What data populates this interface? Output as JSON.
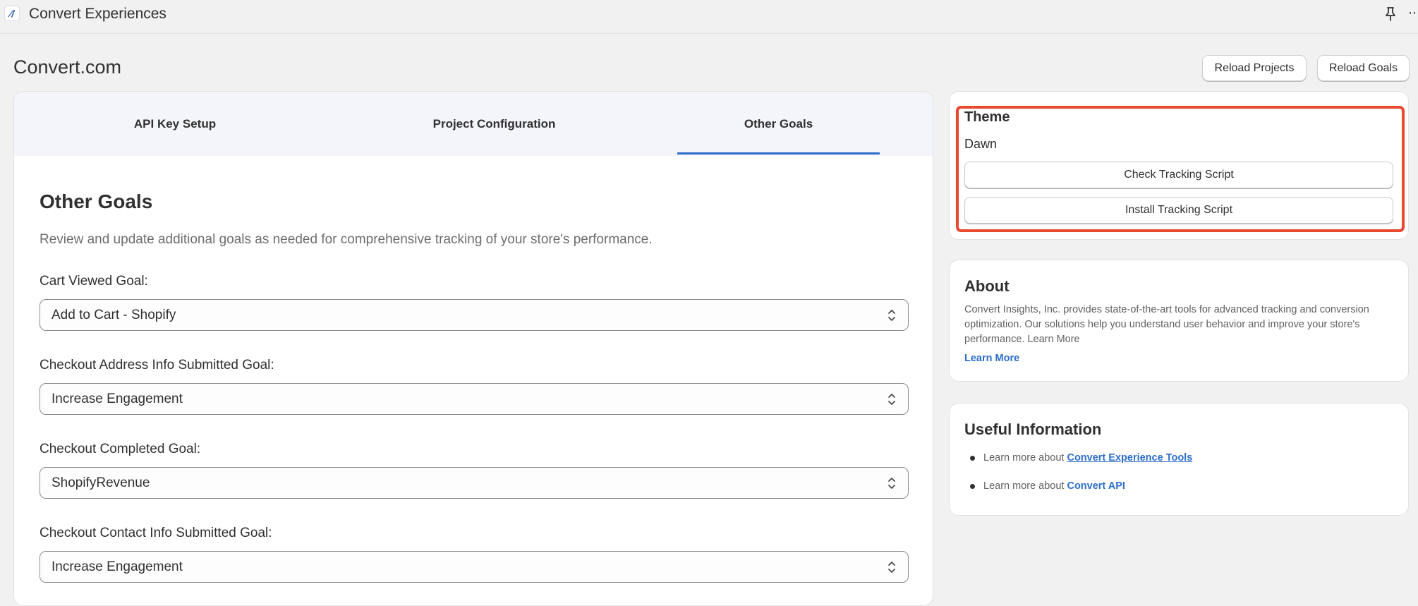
{
  "app": {
    "title": "Convert Experiences",
    "logo_glyph": "∕/"
  },
  "header": {
    "page_title": "Convert.com",
    "reload_projects": "Reload Projects",
    "reload_goals": "Reload Goals"
  },
  "tabs": [
    {
      "label": "API Key Setup"
    },
    {
      "label": "Project Configuration"
    },
    {
      "label": "Other Goals",
      "active": true
    }
  ],
  "main": {
    "title": "Other Goals",
    "description": "Review and update additional goals as needed for comprehensive tracking of your store's performance.",
    "fields": [
      {
        "label": "Cart Viewed Goal:",
        "value": "Add to Cart - Shopify"
      },
      {
        "label": "Checkout Address Info Submitted Goal:",
        "value": "Increase Engagement"
      },
      {
        "label": "Checkout Completed Goal:",
        "value": "ShopifyRevenue"
      },
      {
        "label": "Checkout Contact Info Submitted Goal:",
        "value": "Increase Engagement"
      }
    ]
  },
  "theme": {
    "title": "Theme",
    "value": "Dawn",
    "check_button": "Check Tracking Script",
    "install_button": "Install Tracking Script",
    "highlight_color": "#e8482f"
  },
  "about": {
    "title": "About",
    "text": "Convert Insights, Inc. provides state-of-the-art tools for advanced tracking and conversion optimization. Our solutions help you understand user behavior and improve your store's performance. Learn More",
    "link": "Learn More"
  },
  "useful_info": {
    "title": "Useful Information",
    "items": [
      {
        "prefix": "Learn more about",
        "link": "Convert Experience Tools"
      },
      {
        "prefix": "Learn more about",
        "link": "Convert API"
      }
    ]
  },
  "colors": {
    "accent": "#2c6ecb",
    "background": "#f1f1f1"
  }
}
